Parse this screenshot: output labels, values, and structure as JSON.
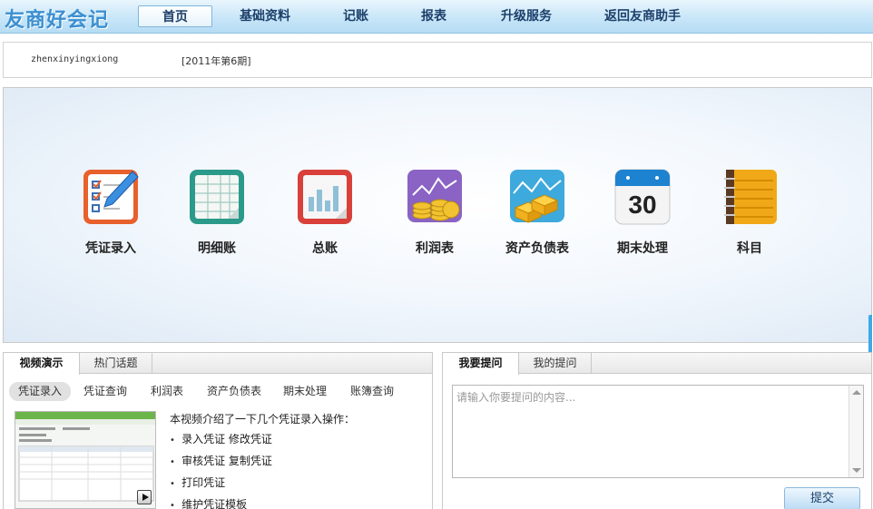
{
  "app": {
    "logo": "友商好会记"
  },
  "nav": [
    {
      "label": "首页",
      "active": true
    },
    {
      "label": "基础资料"
    },
    {
      "label": "记账"
    },
    {
      "label": "报表"
    },
    {
      "label": "升级服务"
    },
    {
      "label": "返回友商助手"
    }
  ],
  "user": {
    "name": "zhenxinyingxiong",
    "period": "[2011年第6期]"
  },
  "apps": [
    {
      "label": "凭证录入",
      "icon": "voucher-entry-icon"
    },
    {
      "label": "明细账",
      "icon": "detail-ledger-icon"
    },
    {
      "label": "总账",
      "icon": "general-ledger-icon"
    },
    {
      "label": "利润表",
      "icon": "income-statement-icon"
    },
    {
      "label": "资产负债表",
      "icon": "balance-sheet-icon"
    },
    {
      "label": "期末处理",
      "icon": "calendar-icon"
    },
    {
      "label": "科目",
      "icon": "notebook-icon"
    }
  ],
  "calendar_day": "30",
  "video": {
    "tabs": [
      {
        "label": "视频演示",
        "active": true
      },
      {
        "label": "热门话题"
      }
    ],
    "subtabs": [
      {
        "label": "凭证录入",
        "active": true
      },
      {
        "label": "凭证查询"
      },
      {
        "label": "利润表"
      },
      {
        "label": "资产负债表"
      },
      {
        "label": "期末处理"
      },
      {
        "label": "账簿查询"
      }
    ],
    "intro": "本视频介绍了一下几个凭证录入操作：",
    "items": [
      "录入凭证 修改凭证",
      "审核凭证 复制凭证",
      "打印凭证",
      "维护凭证模板"
    ]
  },
  "question": {
    "tabs": [
      {
        "label": "我要提问",
        "active": true
      },
      {
        "label": "我的提问"
      }
    ],
    "placeholder": "请输入你要提问的内容...",
    "submit": "提交"
  },
  "colors": {
    "accent": "#3c8fd0",
    "nav_bg": "#c8e6f8"
  }
}
